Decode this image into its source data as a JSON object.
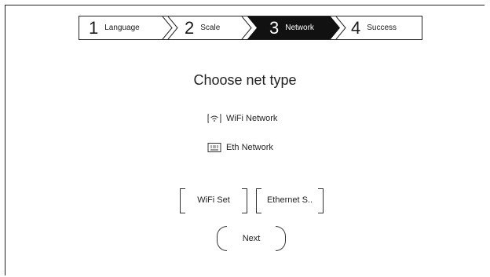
{
  "stepper": {
    "steps": [
      {
        "num": "1",
        "label": "Language"
      },
      {
        "num": "2",
        "label": "Scale"
      },
      {
        "num": "3",
        "label": "Network"
      },
      {
        "num": "4",
        "label": "Success"
      }
    ],
    "active_index": 2
  },
  "title": "Choose net type",
  "options": [
    {
      "label": "WiFi Network",
      "icon": "wifi-icon"
    },
    {
      "label": "Eth Network",
      "icon": "ethernet-icon"
    }
  ],
  "buttons": {
    "wifi_set": "WiFi Set",
    "ethernet_set": "Ethernet S..",
    "next": "Next"
  },
  "colors": {
    "active_step_bg": "#111111",
    "frame": "#222222"
  }
}
